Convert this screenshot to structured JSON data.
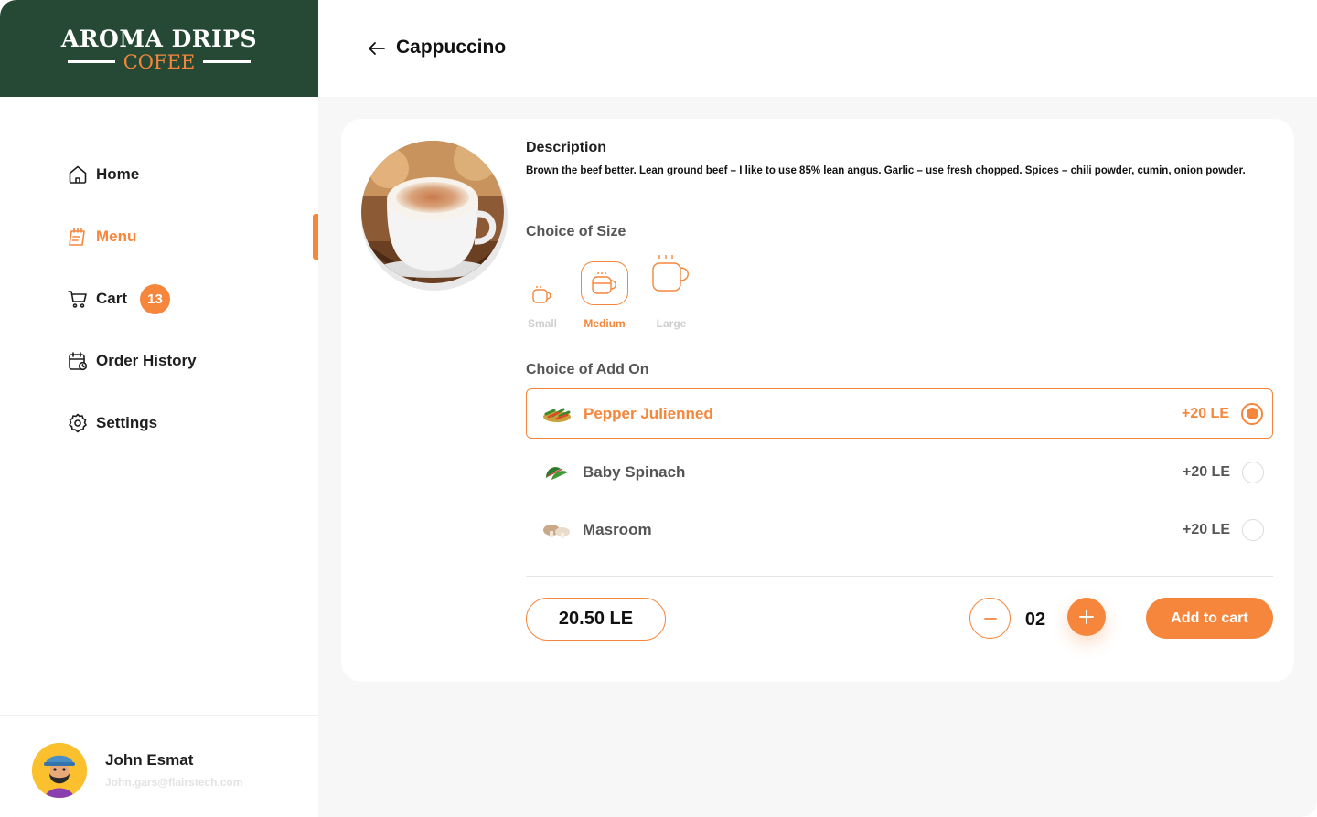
{
  "brand": {
    "name_top": "AROMA DRIPS",
    "name_bottom": "COFEE"
  },
  "colors": {
    "accent": "#f5863b",
    "brand_green": "#254934"
  },
  "nav": {
    "home": "Home",
    "menu": "Menu",
    "cart": "Cart",
    "cart_count": "13",
    "order_history": "Order History",
    "settings": "Settings"
  },
  "user": {
    "name": "John Esmat",
    "email": "John.gars@flairstech.com"
  },
  "header": {
    "title": "Cappuccino"
  },
  "product": {
    "description_title": "Description",
    "description": "Brown the beef better. Lean ground beef – I like to use 85% lean angus. Garlic – use fresh  chopped. Spices – chili powder, cumin, onion powder."
  },
  "size": {
    "title": "Choice of Size",
    "options": [
      {
        "label": "Small",
        "icon": "small-cup-icon"
      },
      {
        "label": "Medium",
        "icon": "medium-cup-icon",
        "selected": true
      },
      {
        "label": "Large",
        "icon": "large-cup-icon"
      }
    ]
  },
  "addons": {
    "title": "Choice of Add On",
    "items": [
      {
        "name": "Pepper Julienned",
        "price": "+20 LE",
        "selected": true
      },
      {
        "name": "Baby Spinach",
        "price": "+20 LE",
        "selected": false
      },
      {
        "name": "Masroom",
        "price": "+20 LE",
        "selected": false
      }
    ]
  },
  "order": {
    "price": "20.50 LE",
    "quantity": "02",
    "add_to_cart": "Add to cart"
  }
}
